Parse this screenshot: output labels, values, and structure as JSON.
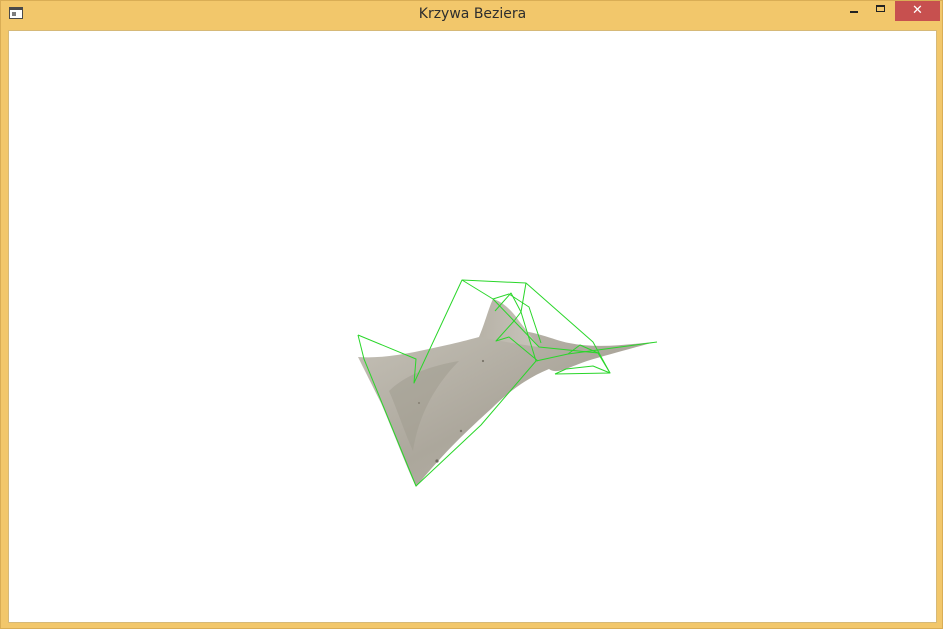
{
  "window": {
    "title": "Krzywa Beziera",
    "close_glyph": "✕",
    "icons": {
      "app": "app-window-icon",
      "minimize": "minimize-icon",
      "maximize": "maximize-icon",
      "close": "close-icon"
    },
    "colors": {
      "frame": "#f2c76b",
      "close_button": "#c7504f",
      "canvas_background": "#ffffff"
    }
  },
  "viewport": {
    "content": "3d-bezier-surface",
    "surface_color": "#b2ada2",
    "control_polygon_color": "#2ad62a"
  }
}
